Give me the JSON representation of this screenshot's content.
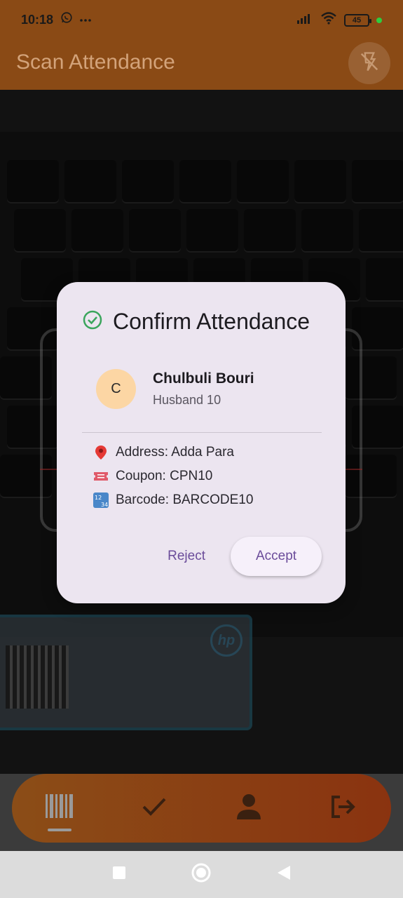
{
  "status_bar": {
    "time": "10:18",
    "notification_icons": [
      "whatsapp-icon",
      "more-dots-icon"
    ],
    "battery_level": "45"
  },
  "app_bar": {
    "title": "Scan Attendance",
    "flash_icon": "flash-off-icon"
  },
  "dialog": {
    "title": "Confirm Attendance",
    "title_icon": "check-circle-icon",
    "person": {
      "avatar_initial": "C",
      "name": "Chulbuli Bouri",
      "subtitle": "Husband 10"
    },
    "details": [
      {
        "icon": "pin-icon",
        "text": "Address: Adda Para"
      },
      {
        "icon": "ticket-icon",
        "text": "Coupon: CPN10"
      },
      {
        "icon": "numbers-icon",
        "text": "Barcode: BARCODE10"
      }
    ],
    "reject_label": "Reject",
    "accept_label": "Accept"
  },
  "bottom_nav": {
    "items": [
      {
        "name": "barcode-icon",
        "selected": true
      },
      {
        "name": "check-icon",
        "selected": false
      },
      {
        "name": "person-icon",
        "selected": false
      },
      {
        "name": "logout-icon",
        "selected": false
      }
    ]
  },
  "colors": {
    "accent_dim": "#8a4a15",
    "dialog_bg": "#ece5f0",
    "button_text": "#6b4c9a",
    "avatar_bg": "#fcd6a4",
    "success": "#3aa55c"
  }
}
